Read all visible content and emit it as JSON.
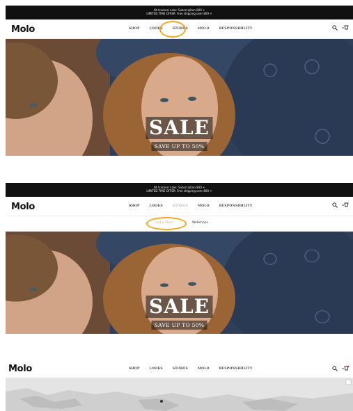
{
  "promo": {
    "line1": "Alt tracked rules: Subscription 800 +",
    "line2": "LIMITED TIME OFFER: Free shipping over 800 +"
  },
  "brand": {
    "logo": "Molo"
  },
  "nav": {
    "shop": "SHOP",
    "looks": "LOOKS",
    "stores": "STORES",
    "molo": "MOLO",
    "responsibility": "RESPONSIBILITY"
  },
  "icons": {
    "search": "search-icon",
    "cart": "cart-icon"
  },
  "hero": {
    "title": "SALE",
    "subtitle": "SAVE UP TO 50%"
  },
  "submenu": {
    "find_a_store": "Find a Store",
    "webshops": "Webshops"
  },
  "colors": {
    "accent_highlight": "#f5a623",
    "promo_bg": "#111111",
    "hat_denim": "#2c3e5c",
    "hair": "#9a6434"
  }
}
